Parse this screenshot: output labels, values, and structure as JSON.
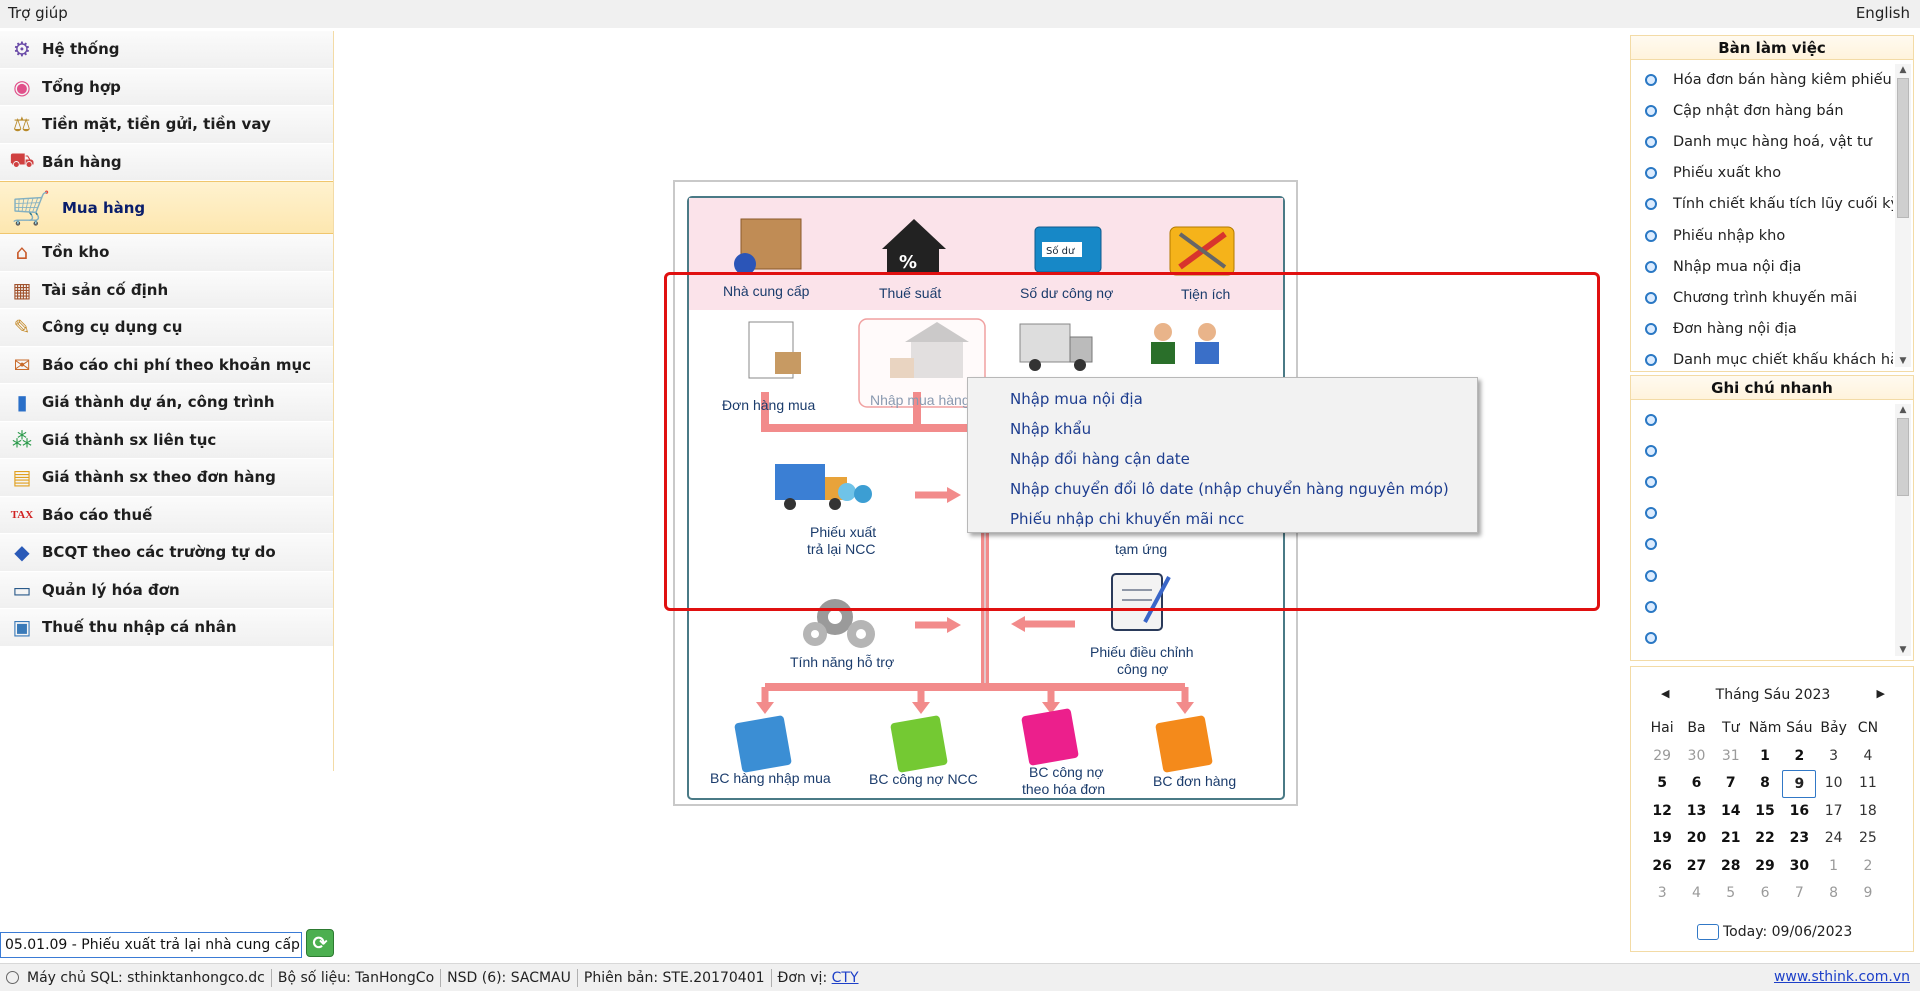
{
  "topbar": {
    "help": "Trợ giúp",
    "language": "English"
  },
  "left_menu": {
    "items": [
      {
        "label": "Hệ thống",
        "icon": "system-icon"
      },
      {
        "label": "Tổng hợp",
        "icon": "summary-icon"
      },
      {
        "label": "Tiền mặt, tiền gửi, tiền vay",
        "icon": "cash-icon"
      },
      {
        "label": "Bán hàng",
        "icon": "sales-icon"
      },
      {
        "label": "Mua hàng",
        "icon": "cart-icon",
        "active": true
      },
      {
        "label": "Tồn kho",
        "icon": "warehouse-icon"
      },
      {
        "label": "Tài sản cố định",
        "icon": "assets-icon"
      },
      {
        "label": "Công cụ dụng cụ",
        "icon": "tools-icon"
      },
      {
        "label": "Báo cáo chi phí theo khoản mục",
        "icon": "expense-icon"
      },
      {
        "label": "Giá thành dự án, công trình",
        "icon": "project-cost-icon"
      },
      {
        "label": "Giá thành sx liên tục",
        "icon": "continuous-cost-icon"
      },
      {
        "label": "Giá thành sx theo đơn hàng",
        "icon": "order-cost-icon"
      },
      {
        "label": "Báo cáo thuế",
        "icon": "tax-icon"
      },
      {
        "label": "BCQT theo các trường tự do",
        "icon": "bcqt-icon"
      },
      {
        "label": "Quản lý hóa đơn",
        "icon": "invoice-icon"
      },
      {
        "label": "Thuế thu nhập cá nhân",
        "icon": "income-tax-icon"
      }
    ]
  },
  "command": {
    "value": "05.01.09 - Phiếu xuất trả lại nhà cung cấp",
    "go_icon": "refresh-go-icon"
  },
  "diagram": {
    "top_row": [
      "Nhà cung cấp",
      "Thuế suất",
      "Số dư công nợ",
      "Tiện ích"
    ],
    "so_du_tag": "Số dư",
    "mid_row": [
      "Đơn hàng mua",
      "Nhập mua hàng"
    ],
    "return_voucher": [
      "Phiếu xuất",
      "trả lại NCC"
    ],
    "advance": "tạm ứng",
    "support": "Tính năng hỗ trợ",
    "adjust": [
      "Phiếu điều chỉnh",
      "công nợ"
    ],
    "reports": [
      "BC hàng nhập mua",
      "BC công nợ NCC",
      "BC công nợ",
      "theo hóa đơn",
      "BC đơn hàng"
    ]
  },
  "context_menu": {
    "items": [
      "Nhập mua nội địa",
      "Nhập khẩu",
      "Nhập đổi hàng cận date",
      "Nhập chuyển đổi lô date (nhập chuyển hàng nguyên móp)",
      "Phiếu nhập chi khuyến mãi ncc"
    ]
  },
  "workdesk": {
    "title": "Bàn làm việc",
    "items": [
      "Hóa đơn bán hàng kiêm phiếu xuất",
      "Cập nhật đơn hàng bán",
      "Danh mục hàng hoá, vật tư",
      "Phiếu xuất kho",
      "Tính chiết khấu tích lũy cuối kỳ",
      "Phiếu nhập kho",
      "Nhập mua nội địa",
      "Chương trình khuyến mãi",
      "Đơn hàng nội địa",
      "Danh mục chiết khấu khách hàng"
    ]
  },
  "quicknotes": {
    "title": "Ghi chú nhanh",
    "count": 8
  },
  "calendar": {
    "month_label": "Tháng Sáu 2023",
    "weekdays": [
      "Hai",
      "Ba",
      "Tư",
      "Năm",
      "Sáu",
      "Bảy",
      "CN"
    ],
    "weeks": [
      [
        [
          "29",
          "o"
        ],
        [
          "30",
          "o"
        ],
        [
          "31",
          "o"
        ],
        [
          "1",
          "c"
        ],
        [
          "2",
          "c"
        ],
        [
          "3",
          "w"
        ],
        [
          "4",
          "w"
        ]
      ],
      [
        [
          "5",
          "c"
        ],
        [
          "6",
          "c"
        ],
        [
          "7",
          "c"
        ],
        [
          "8",
          "c"
        ],
        [
          "9",
          "t"
        ],
        [
          "10",
          "w"
        ],
        [
          "11",
          "w"
        ]
      ],
      [
        [
          "12",
          "c"
        ],
        [
          "13",
          "c"
        ],
        [
          "14",
          "c"
        ],
        [
          "15",
          "c"
        ],
        [
          "16",
          "c"
        ],
        [
          "17",
          "w"
        ],
        [
          "18",
          "w"
        ]
      ],
      [
        [
          "19",
          "c"
        ],
        [
          "20",
          "c"
        ],
        [
          "21",
          "c"
        ],
        [
          "22",
          "c"
        ],
        [
          "23",
          "c"
        ],
        [
          "24",
          "w"
        ],
        [
          "25",
          "w"
        ]
      ],
      [
        [
          "26",
          "c"
        ],
        [
          "27",
          "c"
        ],
        [
          "28",
          "c"
        ],
        [
          "29",
          "c"
        ],
        [
          "30",
          "c"
        ],
        [
          "1",
          "o"
        ],
        [
          "2",
          "o"
        ]
      ],
      [
        [
          "3",
          "o"
        ],
        [
          "4",
          "o"
        ],
        [
          "5",
          "o"
        ],
        [
          "6",
          "o"
        ],
        [
          "7",
          "o"
        ],
        [
          "8",
          "o"
        ],
        [
          "9",
          "o"
        ]
      ]
    ],
    "today_label": "Today: 09/06/2023"
  },
  "status": {
    "sql": "Máy chủ SQL: sthinktanhongco.dc",
    "db": "Bộ số liệu: TanHongCo",
    "user": "NSD (6): SACMAU",
    "version": "Phiên bản: STE.20170401",
    "unit_label": "Đơn vị:",
    "unit": "CTY",
    "website": "www.sthink.com.vn"
  }
}
